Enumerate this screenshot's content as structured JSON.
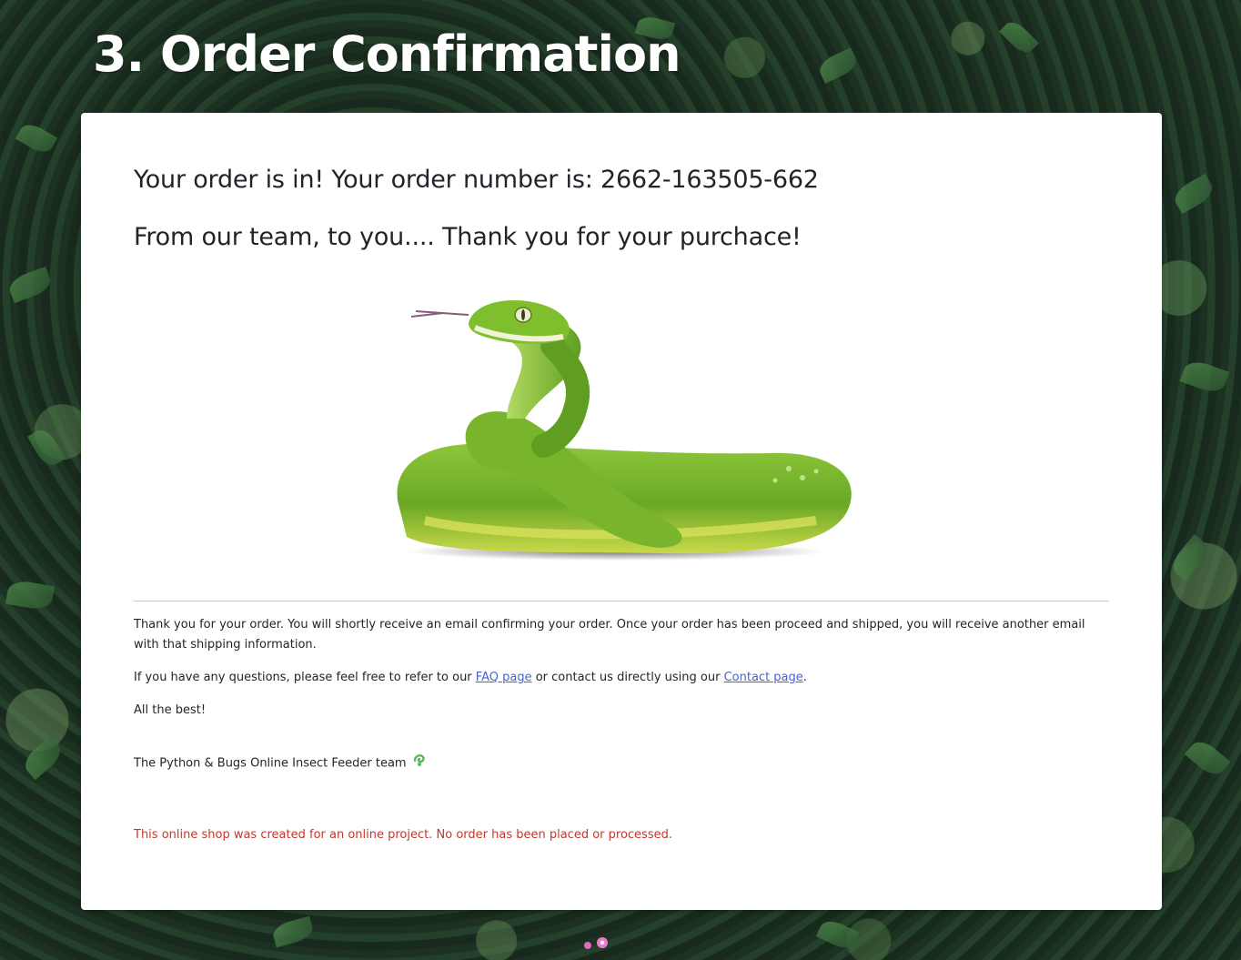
{
  "header": {
    "title": "3. Order Confirmation"
  },
  "confirmation": {
    "order_heading": "Your order is in! Your order number is: 2662-163505-662",
    "thanks_heading": "From our team, to you.... Thank you for your purchace!",
    "image_subject": "green-tree-python"
  },
  "message": {
    "paragraph1": "Thank you for your order. You will shortly receive an email confirming your order. Once your order has been proceed and shipped, you will receive another email with that shipping information.",
    "paragraph2_prefix": "If you have any questions, please feel free to refer to our ",
    "faq_link": "FAQ page",
    "paragraph2_middle": " or contact us directly using our ",
    "contact_link": "Contact page",
    "paragraph2_suffix": ".",
    "signoff": "All the best!",
    "team": "The Python & Bugs Online Insect Feeder team",
    "team_icon": "snake-icon"
  },
  "disclaimer": "This online shop was created for an online project. No order has been placed or processed.",
  "colors": {
    "card_background": "#ffffff",
    "text": "#212529",
    "link": "#4a63c9",
    "disclaimer": "#c0392b",
    "snake_green": "#7dbb2a"
  }
}
